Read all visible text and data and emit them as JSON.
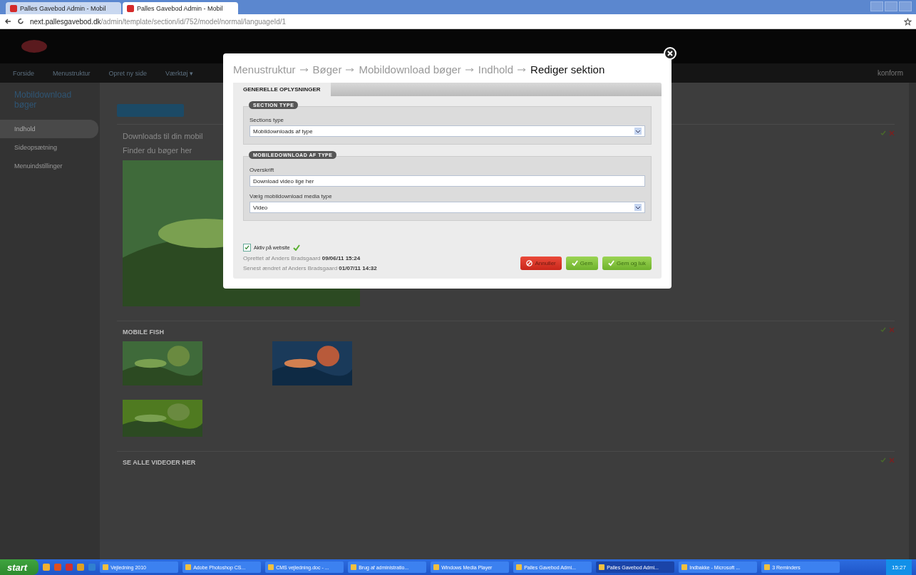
{
  "browser": {
    "tabs": [
      {
        "label": "Palles Gavebod Admin - Mobil",
        "selected": false
      },
      {
        "label": "Palles Gavebod Admin - Mobil",
        "selected": true
      }
    ],
    "address": {
      "host": "next.pallesgavebod.dk",
      "path": "/admin/template/section/id/752/model/normal/languageId/1"
    }
  },
  "header": {
    "nav": [
      "Forside",
      "Menustruktur",
      "Opret ny side",
      "Værktøj ▾"
    ],
    "brand": "konform"
  },
  "sidebar": {
    "title": "Mobildownload bøger",
    "items": [
      {
        "label": "Indhold",
        "selected": true
      },
      {
        "label": "Sideopsætning",
        "selected": false
      },
      {
        "label": "Menuindstillinger",
        "selected": false
      }
    ]
  },
  "sections": [
    {
      "kind": "text",
      "lines": [
        "Downloads til din mobil",
        "Finder du bøger her"
      ]
    },
    {
      "kind": "gallery",
      "title": "MOBILE FISH"
    },
    {
      "kind": "gallery",
      "title": "SE ALLE VIDEOER HER"
    }
  ],
  "modal": {
    "breadcrumb": [
      {
        "label": "Menustruktur",
        "current": false
      },
      {
        "label": "Bøger",
        "current": false
      },
      {
        "label": "Mobildownload bøger",
        "current": false
      },
      {
        "label": "Indhold",
        "current": false
      },
      {
        "label": "Rediger sektion",
        "current": true
      }
    ],
    "tabs": [
      {
        "label": "GENERELLE OPLYSNINGER",
        "selected": true
      }
    ],
    "fieldsets": [
      {
        "legend": "SECTION TYPE",
        "fields": [
          {
            "kind": "select",
            "label": "Sections type",
            "value": "Mobildownloads af type"
          }
        ]
      },
      {
        "legend": "MOBILEDOWNLOAD AF TYPE",
        "fields": [
          {
            "kind": "text",
            "label": "Overskrift",
            "value": "Download video lige her"
          },
          {
            "kind": "select",
            "label": "Vælg mobildownload media type",
            "value": "Video"
          }
        ]
      }
    ],
    "active": {
      "label": "Aktiv på website",
      "checked": true
    },
    "meta": [
      "Oprettet af Anders Bradsgaard **09/06/11 15:24**",
      "Senest ændret af Anders Bradsgaard **01/07/11 14:32**"
    ],
    "buttons": [
      {
        "label": "Annuller",
        "kind": "cancel"
      },
      {
        "label": "Gem",
        "kind": "save"
      },
      {
        "label": "Gem og luk",
        "kind": "save"
      }
    ]
  },
  "taskbar": {
    "start": "start",
    "tasks": [
      {
        "label": "Vejledning 2010",
        "selected": false
      },
      {
        "label": "Adobe Photoshop CS...",
        "selected": false
      },
      {
        "label": "CMS vejledning.doc - ...",
        "selected": false
      },
      {
        "label": "Brug af administratio...",
        "selected": false
      },
      {
        "label": "Windows Media Player",
        "selected": false
      },
      {
        "label": "Palles Gavebod Admi...",
        "selected": false
      },
      {
        "label": "Palles Gavebod Admi...",
        "selected": true
      },
      {
        "label": "Indbakke - Microsoft ...",
        "selected": false
      },
      {
        "label": "3 Reminders",
        "selected": false
      }
    ],
    "clock": "15:27"
  }
}
